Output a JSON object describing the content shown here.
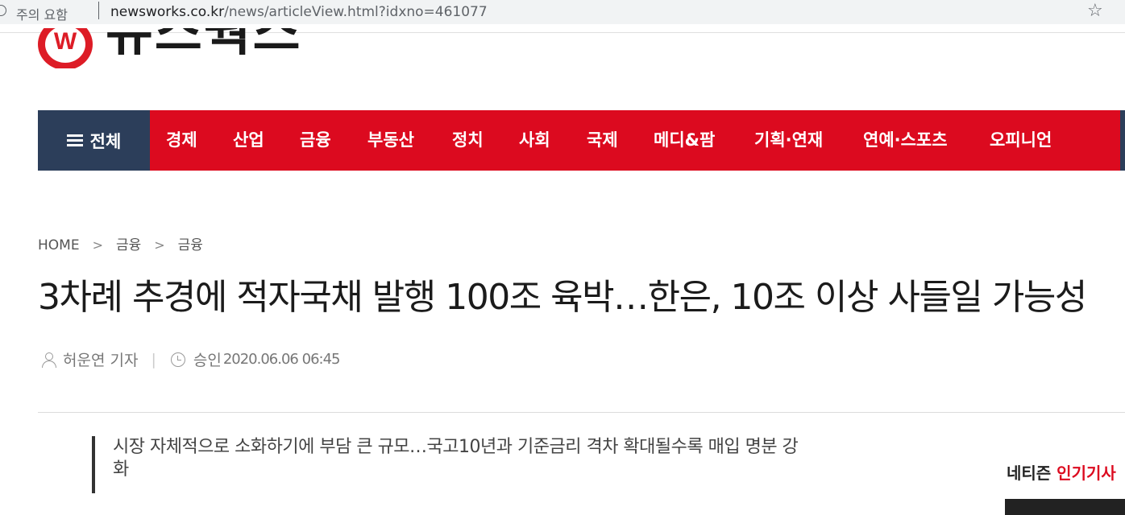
{
  "browser": {
    "security_label": "주의 요함",
    "url_domain": "newsworks.co.kr",
    "url_path": "/news/articleView.html?idxno=461077"
  },
  "site": {
    "logo_mark": "W",
    "logo_text": "뉴스웍스"
  },
  "nav": {
    "all_label": "전체",
    "items": [
      "경제",
      "산업",
      "금융",
      "부동산",
      "정치",
      "사회",
      "국제",
      "메디&팜",
      "기획·연재",
      "연예·스포츠",
      "오피니언"
    ]
  },
  "breadcrumb": [
    "HOME",
    "금융",
    "금융"
  ],
  "article": {
    "headline": "3차례 추경에 적자국채 발행 100조 육박…한은, 10조 이상 사들일 가능성",
    "reporter": "허운연 기자",
    "approved_label": "승인",
    "date": "2020.06.06 06:45",
    "summary_line1": "시장 자체적으로 소화하기에 부담 큰 규모…국고10년과 기준금리 격차 확대될수록 매입 명분 강",
    "summary_line2": "화"
  },
  "sidebar": {
    "title_plain": "네티즌 ",
    "title_accent": "인기기사"
  },
  "colors": {
    "nav_red": "#dc0a1f",
    "nav_navy": "#2c3e5a",
    "logo_red": "#dd1c26"
  }
}
